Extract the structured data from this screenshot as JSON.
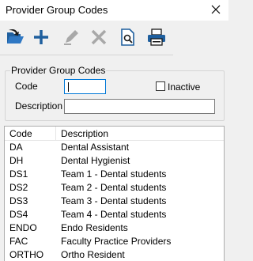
{
  "window": {
    "title": "Provider Group Codes"
  },
  "toolbar": {
    "buttons": [
      {
        "name": "open-icon",
        "enabled": true
      },
      {
        "name": "add-icon",
        "enabled": true
      },
      {
        "name": "edit-icon",
        "enabled": false
      },
      {
        "name": "delete-icon",
        "enabled": false
      },
      {
        "name": "preview-icon",
        "enabled": true
      },
      {
        "name": "print-icon",
        "enabled": true
      }
    ]
  },
  "form": {
    "group_title": "Provider Group Codes",
    "code_label": "Code",
    "code_value": "",
    "inactive_label": "Inactive",
    "inactive_checked": false,
    "description_label": "Description",
    "description_value": ""
  },
  "table": {
    "columns": [
      "Code",
      "Description"
    ],
    "rows": [
      {
        "code": "DA",
        "description": "Dental Assistant"
      },
      {
        "code": "DH",
        "description": "Dental Hygienist"
      },
      {
        "code": "DS1",
        "description": "Team 1 - Dental students"
      },
      {
        "code": "DS2",
        "description": "Team 2 - Dental students"
      },
      {
        "code": "DS3",
        "description": "Team 3 - Dental students"
      },
      {
        "code": "DS4",
        "description": "Team 4 - Dental students"
      },
      {
        "code": "ENDO",
        "description": "Endo Residents"
      },
      {
        "code": "FAC",
        "description": "Faculty Practice Providers"
      },
      {
        "code": "ORTHO",
        "description": "Ortho Resident"
      }
    ]
  },
  "colors": {
    "accent": "#0078d7",
    "icon_blue": "#1f5f9e",
    "disabled": "#a8a8a8"
  }
}
